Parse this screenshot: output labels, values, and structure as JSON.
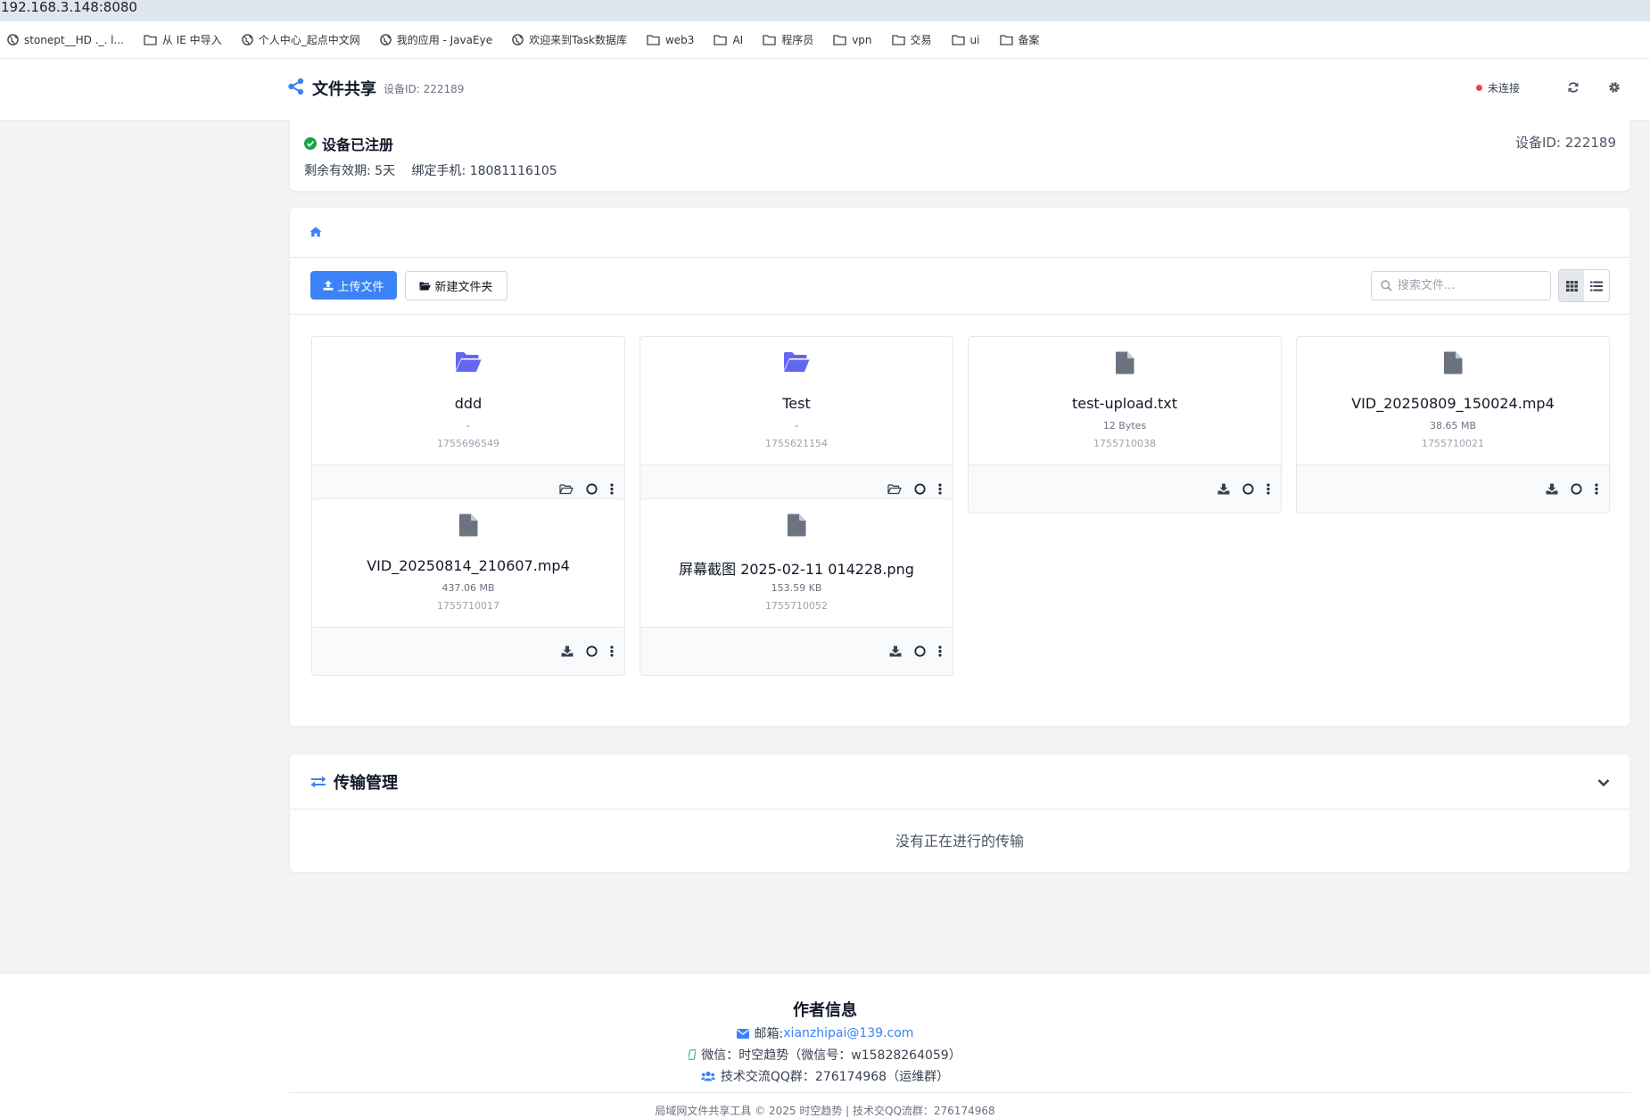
{
  "browser": {
    "url": "192.168.3.148:8080",
    "bookmarks": [
      {
        "label": "stonept__HD ._. l...",
        "icon": "globe-icon"
      },
      {
        "label": "从 IE 中导入",
        "icon": "folder-icon"
      },
      {
        "label": "个人中心_起点中文网",
        "icon": "globe-icon"
      },
      {
        "label": "我的应用 - JavaEye",
        "icon": "globe-icon"
      },
      {
        "label": "欢迎来到Task数据库",
        "icon": "globe-icon"
      },
      {
        "label": "web3",
        "icon": "folder-icon"
      },
      {
        "label": "AI",
        "icon": "folder-icon"
      },
      {
        "label": "程序员",
        "icon": "folder-icon"
      },
      {
        "label": "vpn",
        "icon": "folder-icon"
      },
      {
        "label": "交易",
        "icon": "folder-icon"
      },
      {
        "label": "ui",
        "icon": "folder-icon"
      },
      {
        "label": "备案",
        "icon": "folder-icon"
      }
    ]
  },
  "header": {
    "title": "文件共享",
    "device_id": "设备ID: 222189",
    "status": "未连接",
    "status_color": "#ef4444",
    "accent": "#3b82f6"
  },
  "registration": {
    "title": "设备已注册",
    "remaining": "剩余有效期: 5天",
    "phone": "绑定手机: 18081116105",
    "device_id": "设备ID: 222189"
  },
  "toolbar": {
    "upload_label": "上传文件",
    "new_folder_label": "新建文件夹",
    "search_placeholder": "搜索文件..."
  },
  "files": [
    {
      "name": "ddd",
      "size": "-",
      "time": "1755696549",
      "type": "folder"
    },
    {
      "name": "Test",
      "size": "-",
      "time": "1755621154",
      "type": "folder"
    },
    {
      "name": "test-upload.txt",
      "size": "12 Bytes",
      "time": "1755710038",
      "type": "file"
    },
    {
      "name": "VID_20250809_150024.mp4",
      "size": "38.65 MB",
      "time": "1755710021",
      "type": "file"
    },
    {
      "name": "VID_20250814_210607.mp4",
      "size": "437.06 MB",
      "time": "1755710017",
      "type": "file"
    },
    {
      "name": "屏幕截图 2025-02-11 014228.png",
      "size": "153.59 KB",
      "time": "1755710052",
      "type": "file"
    }
  ],
  "transfer": {
    "title": "传输管理",
    "empty": "没有正在进行的传输"
  },
  "footer": {
    "title": "作者信息",
    "email_label": "邮箱:",
    "email": "xianzhipai@139.com",
    "wechat": "微信：时空趋势（微信号：w15828264059）",
    "qq": "技术交流QQ群：276174968（运维群）",
    "copyright": "局域网文件共享工具 © 2025 时空趋势 | 技术交QQ流群：276174968"
  }
}
